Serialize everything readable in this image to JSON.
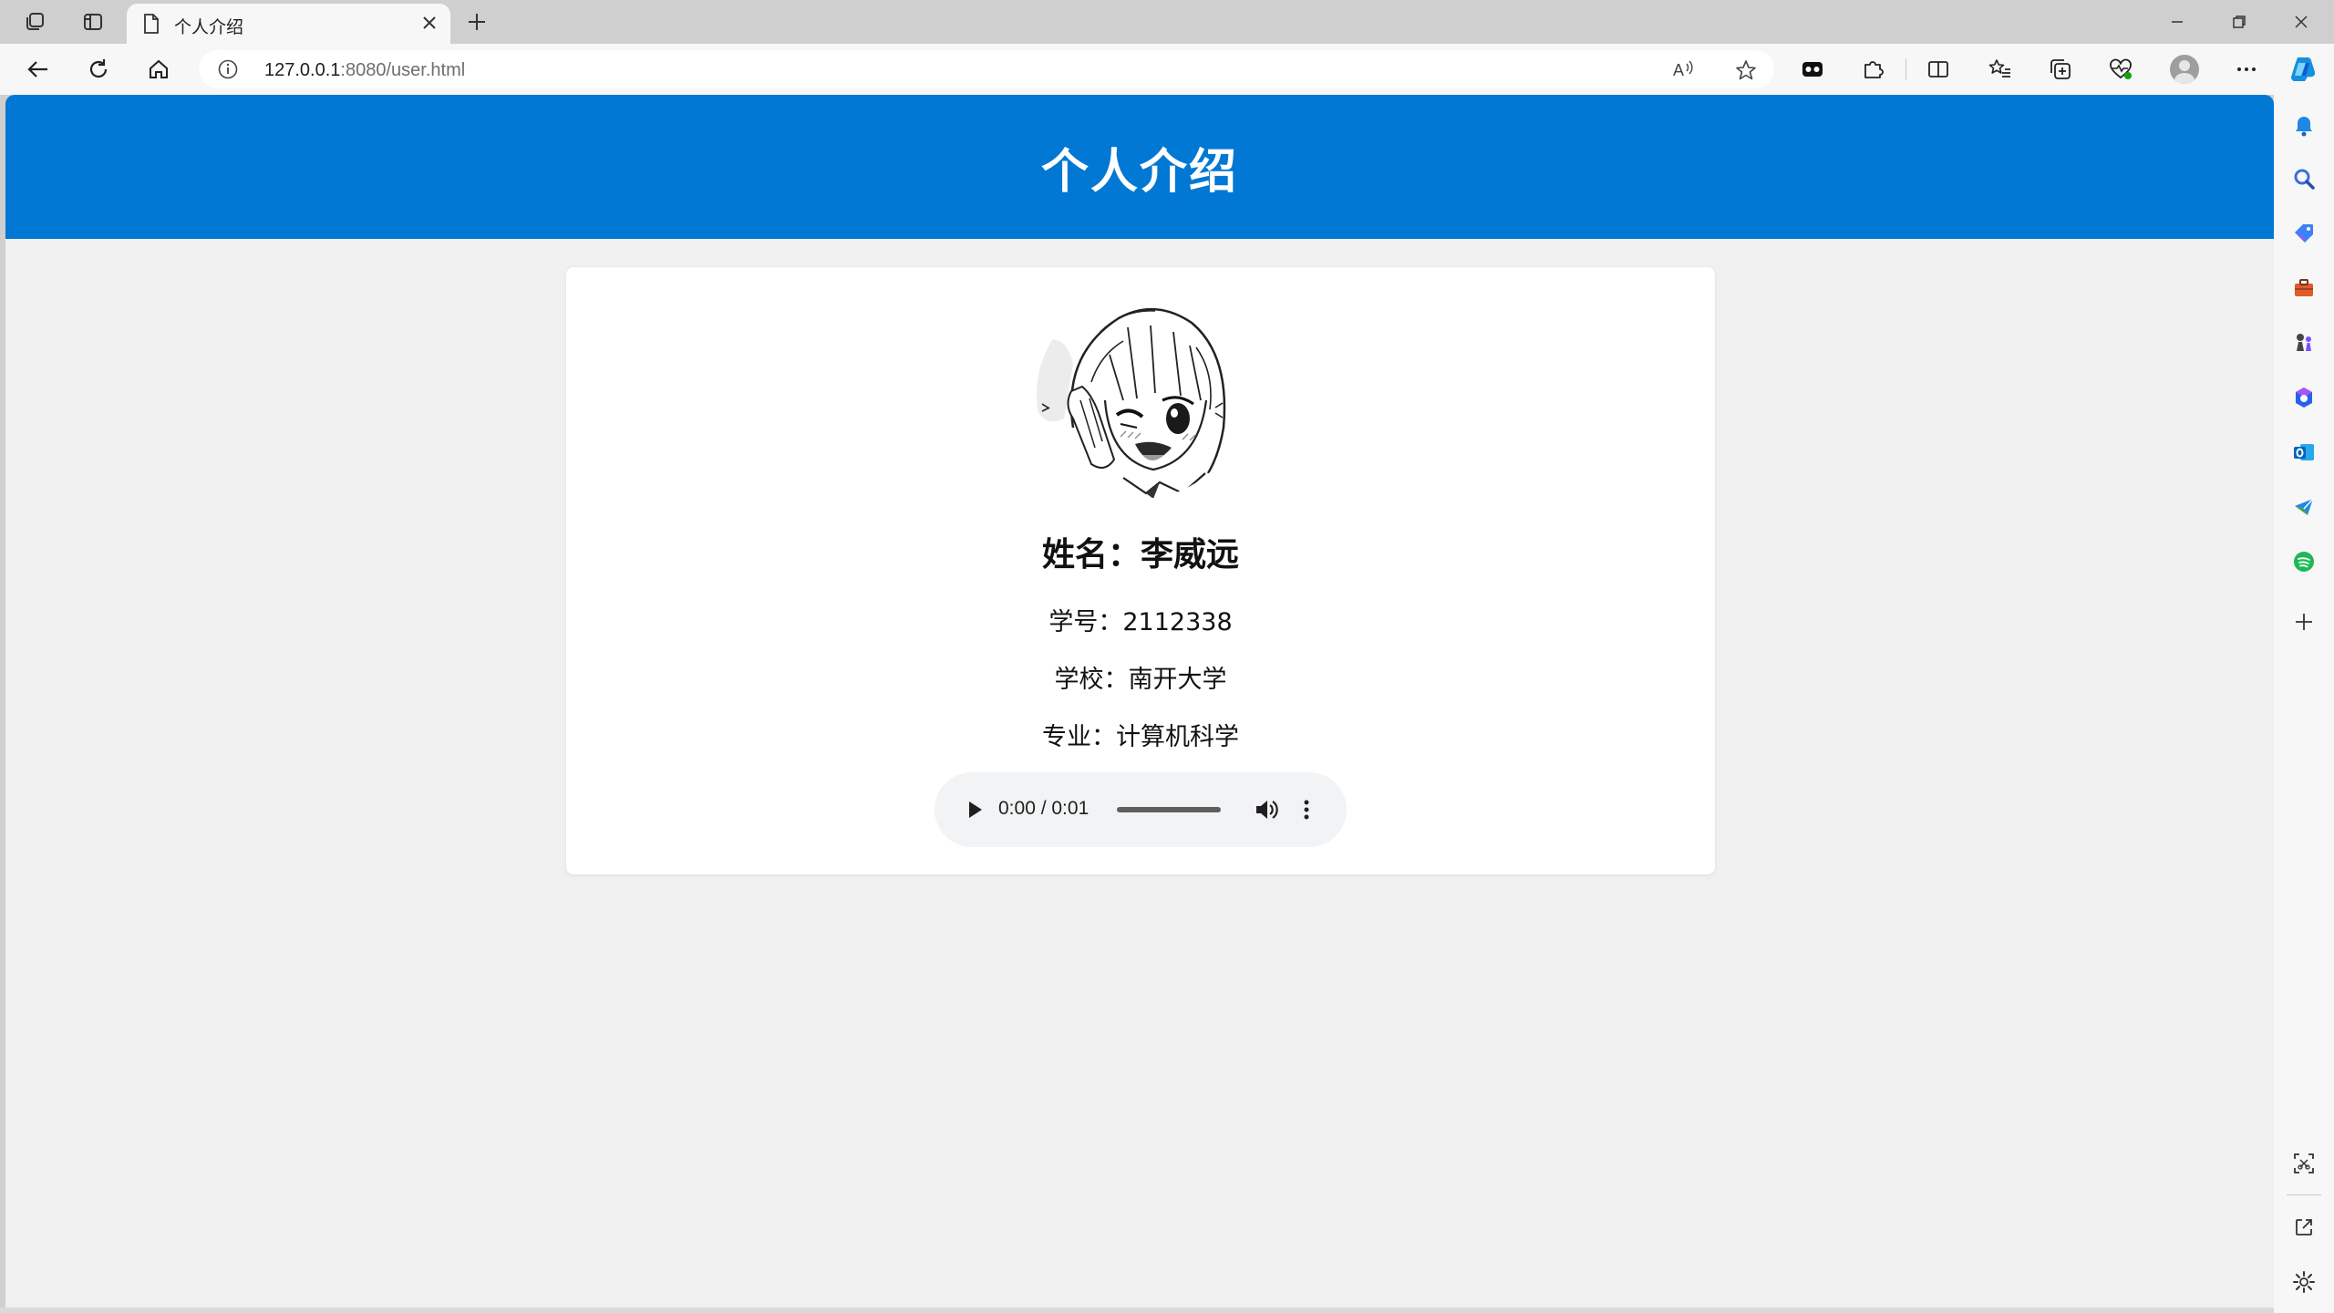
{
  "browser": {
    "tab": {
      "title": "个人介绍"
    },
    "address": {
      "host": "127.0.0.1",
      "rest": ":8080/user.html"
    }
  },
  "page": {
    "header_title": "个人介绍",
    "profile": {
      "name_line": "姓名：李威远",
      "student_id_line": "学号：2112338",
      "school_line": "学校：南开大学",
      "major_line": "专业：计算机科学"
    },
    "audio": {
      "time": "0:00 / 0:01"
    }
  },
  "colors": {
    "header_bg": "#0078d4",
    "page_bg": "#f0f0f0",
    "card_bg": "#ffffff",
    "browser_chrome": "#f7f7f7"
  },
  "icons": {
    "sidebar": [
      "bell-icon",
      "search-icon",
      "tag-icon",
      "briefcase-icon",
      "chess-icon",
      "office-icon",
      "outlook-icon",
      "send-icon",
      "spotify-icon",
      "add-icon",
      "screenshot-icon",
      "open-external-icon",
      "settings-icon"
    ]
  }
}
